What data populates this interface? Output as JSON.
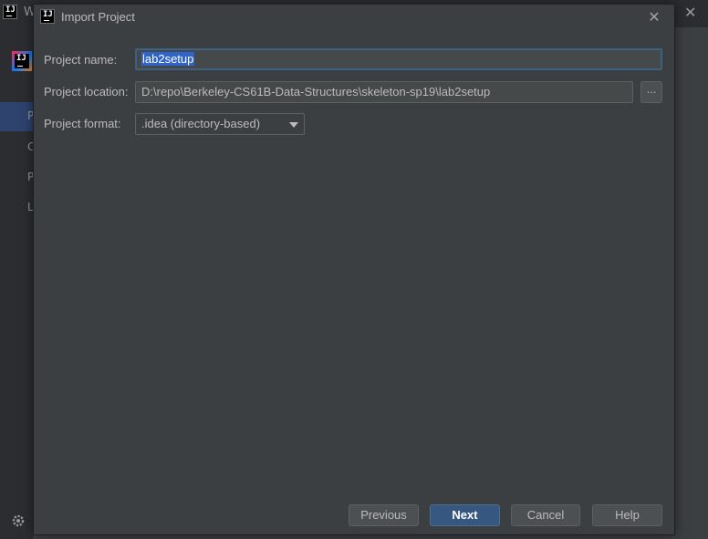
{
  "background": {
    "title_letter": "W",
    "logo_text": "IJ",
    "nav_letters": [
      "P",
      "C",
      "P",
      "L"
    ]
  },
  "dialog": {
    "title": "Import Project",
    "logo_text": "IJ",
    "fields": {
      "project_name_label": "Project name:",
      "project_name_value": "lab2setup",
      "project_location_label": "Project location:",
      "project_location_value": "D:\\repo\\Berkeley-CS61B-Data-Structures\\skeleton-sp19\\lab2setup",
      "browse_label": "...",
      "project_format_label": "Project format:",
      "project_format_value": ".idea (directory-based)"
    },
    "buttons": {
      "previous": "Previous",
      "next": "Next",
      "cancel": "Cancel",
      "help": "Help"
    }
  },
  "colors": {
    "accent": "#365880",
    "selection": "#2f65ca",
    "dialog_bg": "#3c3f41"
  }
}
